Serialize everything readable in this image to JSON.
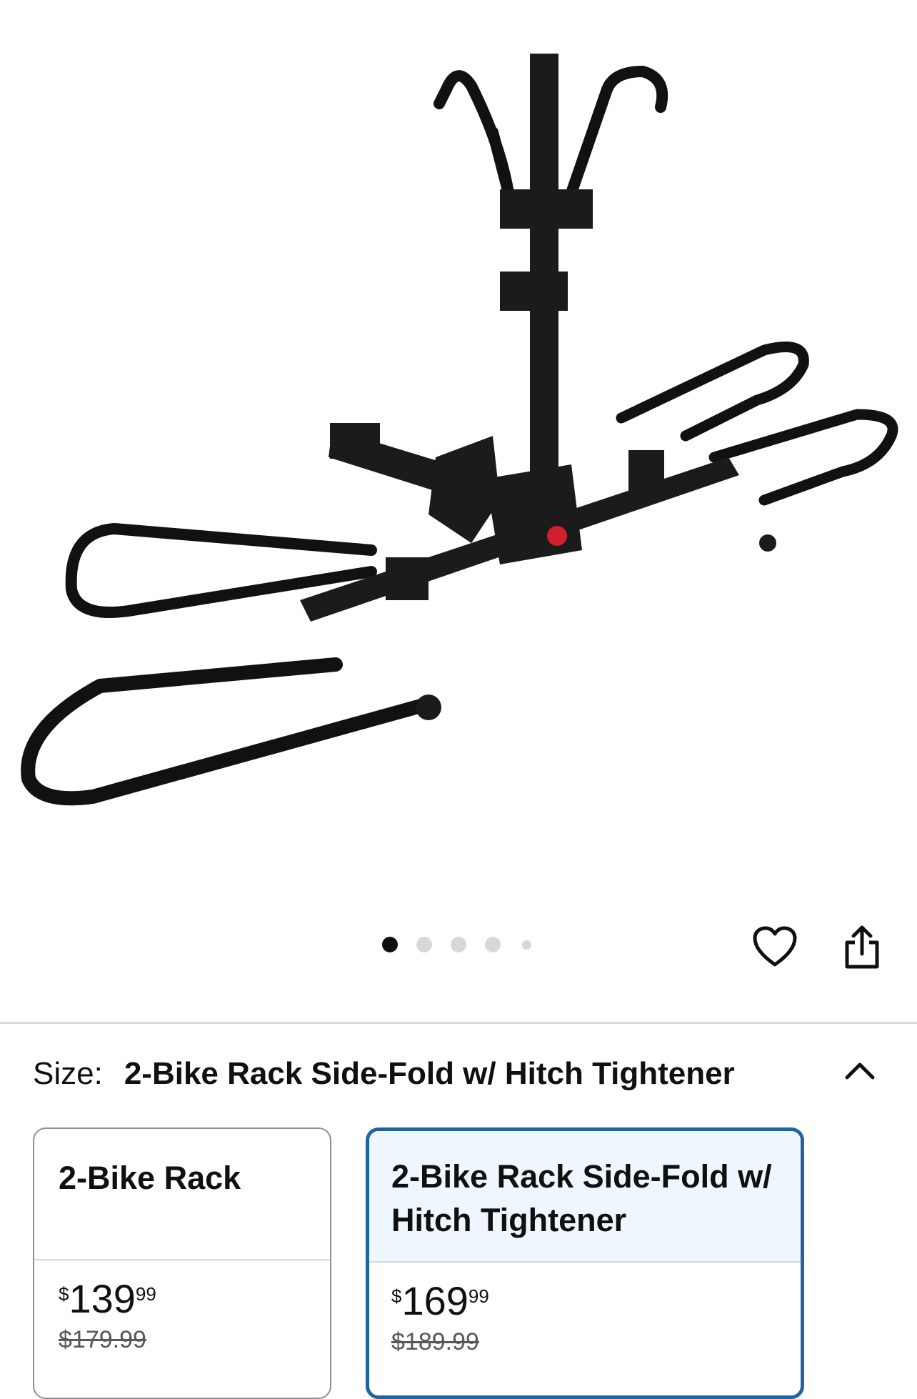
{
  "gallery": {
    "image_alt": "2-Bike hitch rack product photo",
    "dots_total": 5,
    "active_dot": 1,
    "favorite_icon": "heart-outline-icon",
    "share_icon": "share-icon"
  },
  "variation": {
    "label": "Size:",
    "selected_value": "2-Bike Rack Side-Fold w/ Hitch Tightener",
    "toggle_icon": "chevron-up-icon",
    "options": [
      {
        "title": "2-Bike Rack",
        "price_symbol": "$",
        "price_whole": "139",
        "price_fraction": "99",
        "list_price": "$179.99",
        "selected": false
      },
      {
        "title": "2-Bike Rack Side-Fold w/ Hitch Tightener",
        "price_symbol": "$",
        "price_whole": "169",
        "price_fraction": "99",
        "list_price": "$189.99",
        "selected": true
      }
    ]
  },
  "colors": {
    "selected_border": "#2162a1",
    "selected_bg": "#edf7fd",
    "active_dot": "#0f1111",
    "inactive_dot": "#d5d9d9"
  }
}
